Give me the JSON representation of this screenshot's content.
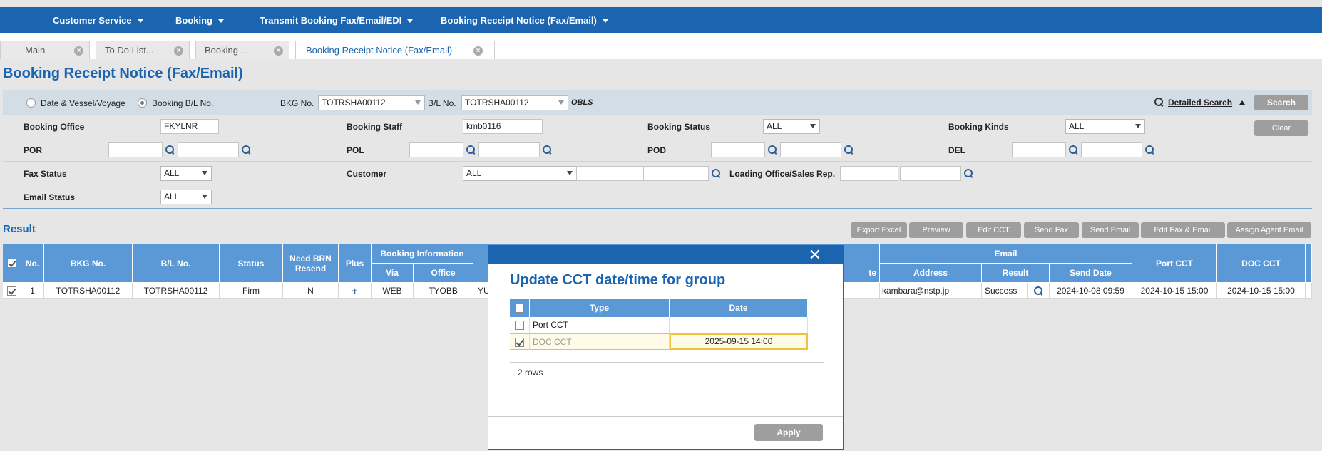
{
  "menu": {
    "items": [
      {
        "label": "Customer Service"
      },
      {
        "label": "Booking"
      },
      {
        "label": "Transmit Booking Fax/Email/EDI"
      },
      {
        "label": "Booking Receipt Notice (Fax/Email)"
      }
    ]
  },
  "tabs": [
    {
      "label": "Main"
    },
    {
      "label": "To Do List..."
    },
    {
      "label": "Booking ..."
    },
    {
      "label": "Booking Receipt Notice (Fax/Email)"
    }
  ],
  "page": {
    "title": "Booking Receipt Notice (Fax/Email)"
  },
  "search": {
    "radio_date_vessel": "Date & Vessel/Voyage",
    "radio_booking_bl": "Booking B/L No.",
    "bkg_label": "BKG No.",
    "bkg_value": "TOTRSHA00112",
    "bl_label": "B/L No.",
    "bl_value": "TOTRSHA00112",
    "obls": "OBLS",
    "detailed_search": "Detailed Search",
    "search_button": "Search",
    "clear_button": "Clear"
  },
  "filters": {
    "booking_office_label": "Booking Office",
    "booking_office_value": "FKYLNR",
    "booking_staff_label": "Booking Staff",
    "booking_staff_value": "kmb0116",
    "booking_status_label": "Booking Status",
    "booking_status_value": "ALL",
    "booking_kinds_label": "Booking Kinds",
    "booking_kinds_value": "ALL",
    "por_label": "POR",
    "pol_label": "POL",
    "pod_label": "POD",
    "del_label": "DEL",
    "fax_status_label": "Fax Status",
    "fax_status_value": "ALL",
    "customer_label": "Customer",
    "customer_value": "ALL",
    "loading_office_label": "Loading Office/Sales Rep.",
    "email_status_label": "Email Status",
    "email_status_value": "ALL"
  },
  "result": {
    "title": "Result",
    "actions": [
      "Export Excel",
      "Preview",
      "Edit CCT",
      "Send Fax",
      "Send Email",
      "Edit Fax & Email",
      "Assign Agent Email"
    ],
    "headers": {
      "no": "No.",
      "bkg_no": "BKG No.",
      "bl_no": "B/L No.",
      "status": "Status",
      "need_brn": "Need BRN Resend",
      "plus": "Plus",
      "booking_info": "Booking Information",
      "via": "Via",
      "office": "Office",
      "te": "te",
      "email": "Email",
      "address": "Address",
      "result": "Result",
      "send_date": "Send Date",
      "port_cct": "Port CCT",
      "doc_cct": "DOC CCT"
    },
    "row": {
      "no": "1",
      "bkg_no": "TOTRSHA00112",
      "bl_no": "TOTRSHA00112",
      "status": "Firm",
      "need_brn": "N",
      "plus": "+",
      "via": "WEB",
      "office": "TYOBB",
      "partial": "YU",
      "address": "kambara@nstp.jp",
      "result": "Success",
      "send_date": "2024-10-08 09:59",
      "port_cct": "2024-10-15 15:00",
      "doc_cct": "2024-10-15 15:00"
    }
  },
  "modal": {
    "close": "✕",
    "title": "Update CCT date/time for group",
    "headers": {
      "type": "Type",
      "date": "Date"
    },
    "rows": [
      {
        "type": "Port CCT",
        "date": ""
      },
      {
        "type": "DOC CCT",
        "date": "2025-09-15 14:00"
      }
    ],
    "row_count": "2 rows",
    "apply": "Apply"
  }
}
